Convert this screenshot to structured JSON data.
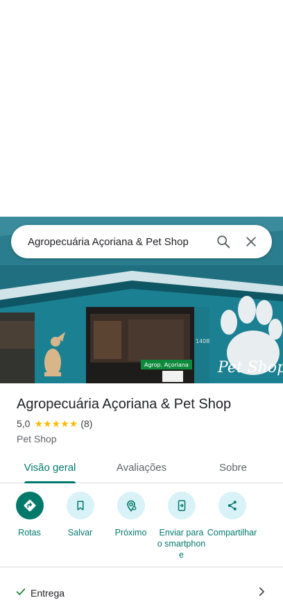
{
  "search": {
    "query": "Agropecuária Açoriana & Pet Shop",
    "search_icon": "search-icon",
    "close_icon": "close-icon"
  },
  "place": {
    "name": "Agropecuária Açoriana & Pet Shop",
    "rating": "5,0",
    "stars": 5,
    "review_count": "(8)",
    "category": "Pet Shop",
    "star_color": "#fbbc04"
  },
  "photo": {
    "sign_text": "Pet Shop",
    "store_sign": "Agrop. Açoriana",
    "number": "1408"
  },
  "tabs": [
    {
      "label": "Visão geral",
      "active": true
    },
    {
      "label": "Avaliações",
      "active": false
    },
    {
      "label": "Sobre",
      "active": false
    }
  ],
  "actions": [
    {
      "label": "Rotas",
      "icon": "directions-icon"
    },
    {
      "label": "Salvar",
      "icon": "bookmark-icon"
    },
    {
      "label": "Próximo",
      "icon": "nearby-icon"
    },
    {
      "label": "Enviar para o smartphone",
      "icon": "send-to-phone-icon"
    },
    {
      "label": "Compartilhar",
      "icon": "share-icon"
    }
  ],
  "details": [
    {
      "label": "Entrega",
      "icon": "check-icon"
    }
  ],
  "colors": {
    "accent": "#00796b",
    "action_bg": "#d8f2f7"
  }
}
